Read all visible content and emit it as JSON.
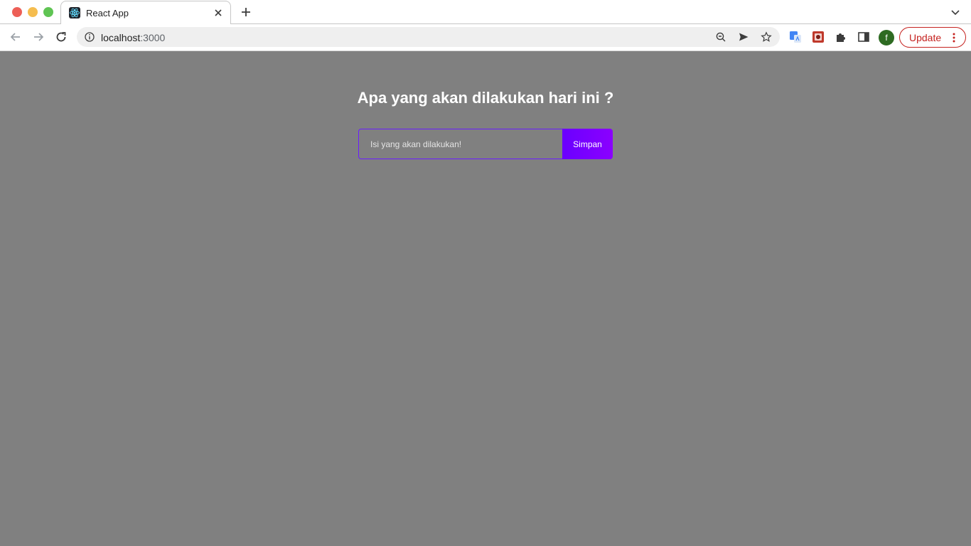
{
  "browser": {
    "tab_title": "React App",
    "address_host": "localhost",
    "address_port": ":3000",
    "profile_initial": "f",
    "update_label": "Update",
    "icons": {
      "favicon": "react-logo-icon",
      "tab_close": "close-icon",
      "new_tab": "plus-icon",
      "tab_search": "chevron-down-icon",
      "back": "arrow-left-icon",
      "forward": "arrow-right-icon",
      "reload": "reload-icon",
      "site_info": "info-icon",
      "zoom": "zoom-out-icon",
      "send": "send-icon",
      "bookmark": "star-icon",
      "translate": "google-translate-icon",
      "extension": "extension-icon",
      "puzzle": "puzzle-icon",
      "side_panel": "side-panel-icon",
      "menu": "more-vert-icon"
    }
  },
  "app": {
    "heading": "Apa yang akan dilakukan hari ini ?",
    "input_placeholder": "Isi yang akan dilakukan!",
    "input_value": "",
    "submit_label": "Simpan"
  },
  "colors": {
    "page_background": "#808080",
    "accent": "#6a00ff",
    "accent_end": "#8b00ff",
    "update_red": "#c5221f"
  }
}
